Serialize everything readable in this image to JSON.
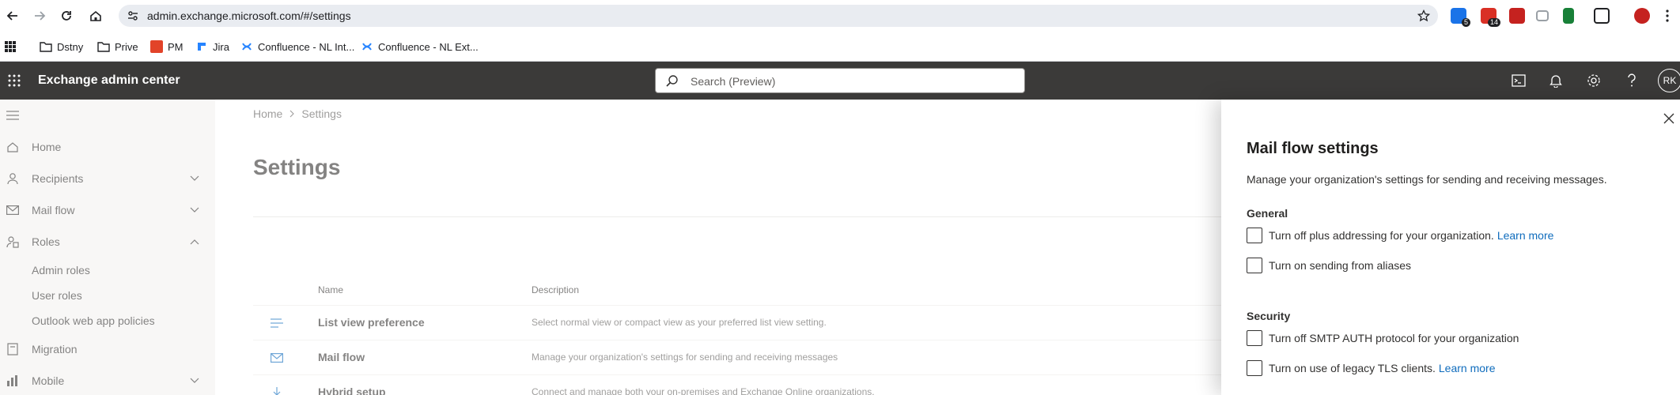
{
  "browser": {
    "url": "admin.exchange.microsoft.com/#/settings",
    "extension_badges": [
      "5",
      "14"
    ]
  },
  "bookmarks": [
    {
      "label": "Dstny",
      "icon": "folder-icon"
    },
    {
      "label": "Prive",
      "icon": "folder-icon"
    },
    {
      "label": "PM",
      "icon": "gitlab-icon"
    },
    {
      "label": "Jira",
      "icon": "jira-icon"
    },
    {
      "label": "Confluence - NL Int...",
      "icon": "confluence-icon"
    },
    {
      "label": "Confluence - NL Ext...",
      "icon": "confluence-icon"
    }
  ],
  "header": {
    "app_title": "Exchange admin center",
    "search_placeholder": "Search (Preview)",
    "avatar_initials": "RK"
  },
  "sidebar": {
    "items": [
      {
        "label": "Home",
        "icon": "home-icon"
      },
      {
        "label": "Recipients",
        "icon": "person-icon"
      },
      {
        "label": "Mail flow",
        "icon": "mail-icon"
      },
      {
        "label": "Roles",
        "icon": "roles-icon"
      },
      {
        "label": "Migration",
        "icon": "migration-icon"
      },
      {
        "label": "Mobile",
        "icon": "mobile-icon"
      }
    ],
    "roles_subitems": [
      "Admin roles",
      "User roles",
      "Outlook web app policies"
    ]
  },
  "main": {
    "breadcrumb": [
      "Home",
      "Settings"
    ],
    "title": "Settings",
    "columns": {
      "name": "Name",
      "description": "Description"
    },
    "rows": [
      {
        "name": "List view preference",
        "description": "Select normal view or compact view as your preferred list view setting.",
        "icon": "list-icon"
      },
      {
        "name": "Mail flow",
        "description": "Manage your organization's settings for sending and receiving messages",
        "icon": "mail-icon"
      },
      {
        "name": "Hybrid setup",
        "description": "Connect and manage both your on-premises and Exchange Online organizations.",
        "icon": "download-icon"
      }
    ]
  },
  "panel": {
    "title": "Mail flow settings",
    "description": "Manage your organization's settings for sending and receiving messages.",
    "general_heading": "General",
    "general_options": [
      {
        "label": "Turn off plus addressing for your organization.",
        "link": "Learn more",
        "checked": false
      },
      {
        "label": "Turn on sending from aliases",
        "link": "",
        "checked": false
      }
    ],
    "security_heading": "Security",
    "security_options": [
      {
        "label": "Turn off SMTP AUTH protocol for your organization",
        "link": "",
        "checked": false
      },
      {
        "label": "Turn on use of legacy TLS clients.",
        "link": "Learn more",
        "checked": false
      }
    ]
  },
  "colors": {
    "suite_header": "#3b3a39",
    "sidebar_bg": "#f3f2f1",
    "link": "#0f6cbd",
    "icon_accent": "#0f6cbd"
  }
}
